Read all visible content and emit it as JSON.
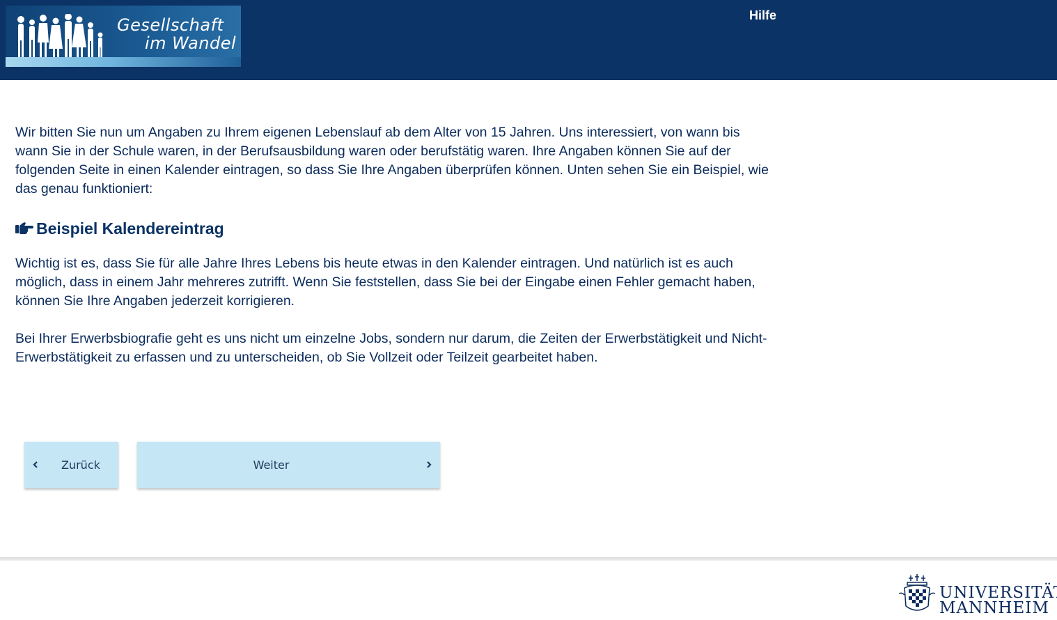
{
  "header": {
    "logo_line1": "Gesellschaft",
    "logo_line2": "im Wandel",
    "help_label": "Hilfe",
    "colors": {
      "background": "#0b3366",
      "text": "#ffffff"
    }
  },
  "main": {
    "intro": "Wir bitten Sie nun um Angaben zu Ihrem eigenen Lebenslauf ab dem Alter von 15 Jahren. Uns interessiert, von wann bis wann Sie in der Schule waren, in der Berufsausbildung waren oder berufstätig waren. Ihre Angaben können Sie auf der folgenden Seite in einen Kalender eintragen, so dass Sie Ihre Angaben überprüfen können. Unten sehen Sie ein Beispiel, wie das genau funktioniert:",
    "example_heading": "Beispiel Kalendereintrag",
    "example_icon": "hand-pointing-right-icon",
    "paragraph2": "Wichtig ist es, dass Sie für alle Jahre Ihres Lebens bis heute etwas in den Kalender eintragen. Und natürlich ist es auch möglich, dass in einem Jahr mehreres zutrifft. Wenn Sie feststellen, dass Sie bei der Eingabe einen Fehler gemacht haben, können Sie Ihre Angaben jederzeit korrigieren.",
    "paragraph3": "Bei Ihrer Erwerbsbiografie geht es uns nicht um einzelne Jobs, sondern nur darum, die Zeiten der Erwerbstätigkeit und Nicht-Erwerbstätigkeit zu erfassen und zu unterscheiden, ob Sie Vollzeit oder Teilzeit gearbeitet haben."
  },
  "navigation": {
    "back_label": "Zurück",
    "next_label": "Weiter",
    "button_color": "#c5e6f4"
  },
  "footer": {
    "university_line1": "UNIVERSITÄT",
    "university_line2": "MANNHEIM"
  }
}
